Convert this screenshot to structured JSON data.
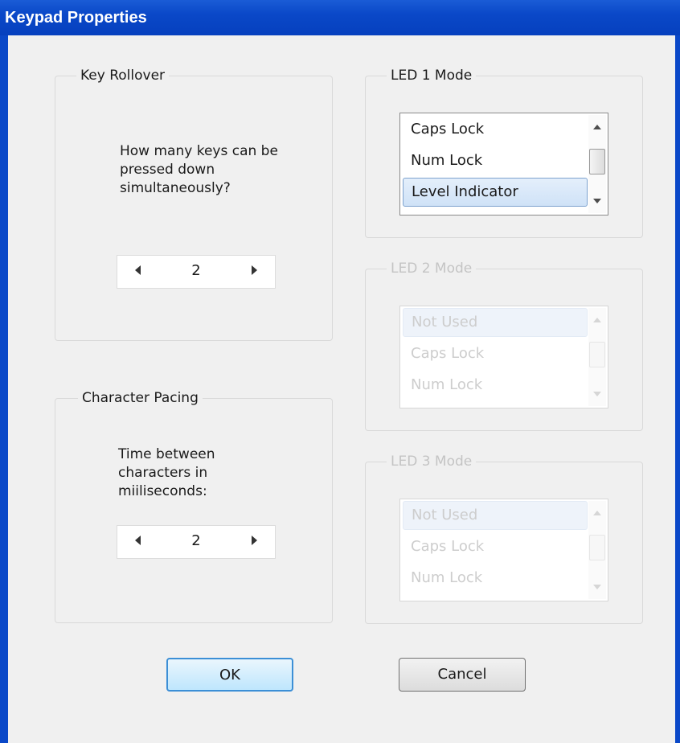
{
  "window": {
    "title": "Keypad Properties"
  },
  "key_rollover": {
    "legend": "Key Rollover",
    "description": [
      "How many keys can be",
      "pressed down",
      "simultaneously?"
    ],
    "value": "2"
  },
  "character_pacing": {
    "legend": "Character Pacing",
    "description": [
      "Time between",
      "characters in",
      "miiliseconds:"
    ],
    "value": "2"
  },
  "led1": {
    "legend": "LED 1 Mode",
    "items": [
      "Caps Lock",
      "Num Lock",
      "Level Indicator"
    ],
    "selected": "Level Indicator"
  },
  "led2": {
    "legend": "LED 2 Mode",
    "items": [
      "Not Used",
      "Caps Lock",
      "Num Lock"
    ],
    "selected": "Not Used"
  },
  "led3": {
    "legend": "LED 3 Mode",
    "items": [
      "Not Used",
      "Caps Lock",
      "Num Lock"
    ],
    "selected": "Not Used"
  },
  "buttons": {
    "ok": "OK",
    "cancel": "Cancel"
  }
}
